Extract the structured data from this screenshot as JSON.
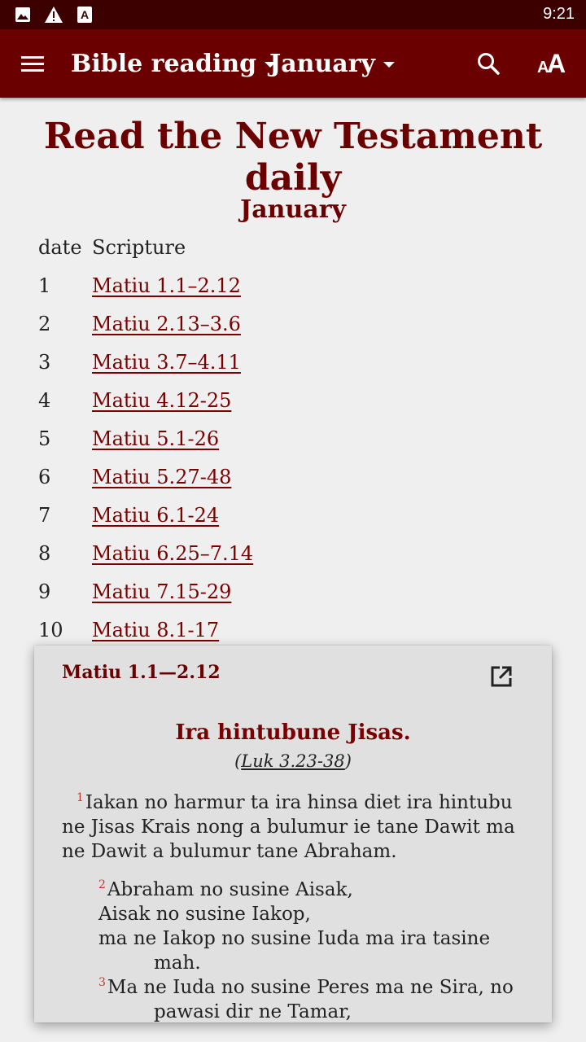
{
  "status_bar": {
    "time": "9:21",
    "icons": [
      "image-icon",
      "warning-icon",
      "text-a-icon"
    ]
  },
  "app_bar": {
    "book_selector": "Bible reading",
    "month_selector": "January",
    "icons": [
      "menu-icon",
      "search-icon",
      "font-size-icon"
    ]
  },
  "page": {
    "title": "Read the New Testament daily",
    "month_heading": "January",
    "columns": {
      "date": "date",
      "scripture": "Scripture"
    },
    "rows": [
      {
        "date": "1",
        "ref": "Matiu 1.1–2.12"
      },
      {
        "date": "2",
        "ref": "Matiu 2.13–3.6"
      },
      {
        "date": "3",
        "ref": "Matiu 3.7–4.11"
      },
      {
        "date": "4",
        "ref": "Matiu 4.12-25"
      },
      {
        "date": "5",
        "ref": "Matiu 5.1-26"
      },
      {
        "date": "6",
        "ref": "Matiu 5.27-48"
      },
      {
        "date": "7",
        "ref": "Matiu 6.1-24"
      },
      {
        "date": "8",
        "ref": "Matiu 6.25–7.14"
      },
      {
        "date": "9",
        "ref": "Matiu 7.15-29"
      },
      {
        "date": "10",
        "ref": "Matiu 8.1-17"
      }
    ]
  },
  "popup": {
    "reference": "Matiu 1.1—2.12",
    "open_icon": "open-external-icon",
    "section_heading": "Ira hintubune Jisas.",
    "parallel_open": "(",
    "parallel_ref": "Luk 3.23-38",
    "parallel_close": ")",
    "verse1_num": "1",
    "verse1_text": "Iakan no harmur ta ira hinsa diet ira hintubu ne Jisas Krais nong a bulumur ie tane Dawit ma ne Dawit a bulumur tane Abraham.",
    "verse2_num": "2",
    "verse2_line1": "Abraham no susine Aisak,",
    "verse2_line2": "Aisak no susine Iakop,",
    "verse2_line3": "ma ne Iakop no susine Iuda ma ira tasine",
    "verse2_line4": "mah.",
    "verse3_num": "3",
    "verse3_line1": "Ma ne Iuda no susine Peres ma ne Sira, no",
    "verse3_line2": "pawasi dir ne Tamar,"
  },
  "colors": {
    "app_bar": "#6b0000",
    "status_bar": "#3d0000",
    "accent_text": "#6b0000",
    "link": "#7a0000",
    "verse_number": "#c0392b"
  }
}
